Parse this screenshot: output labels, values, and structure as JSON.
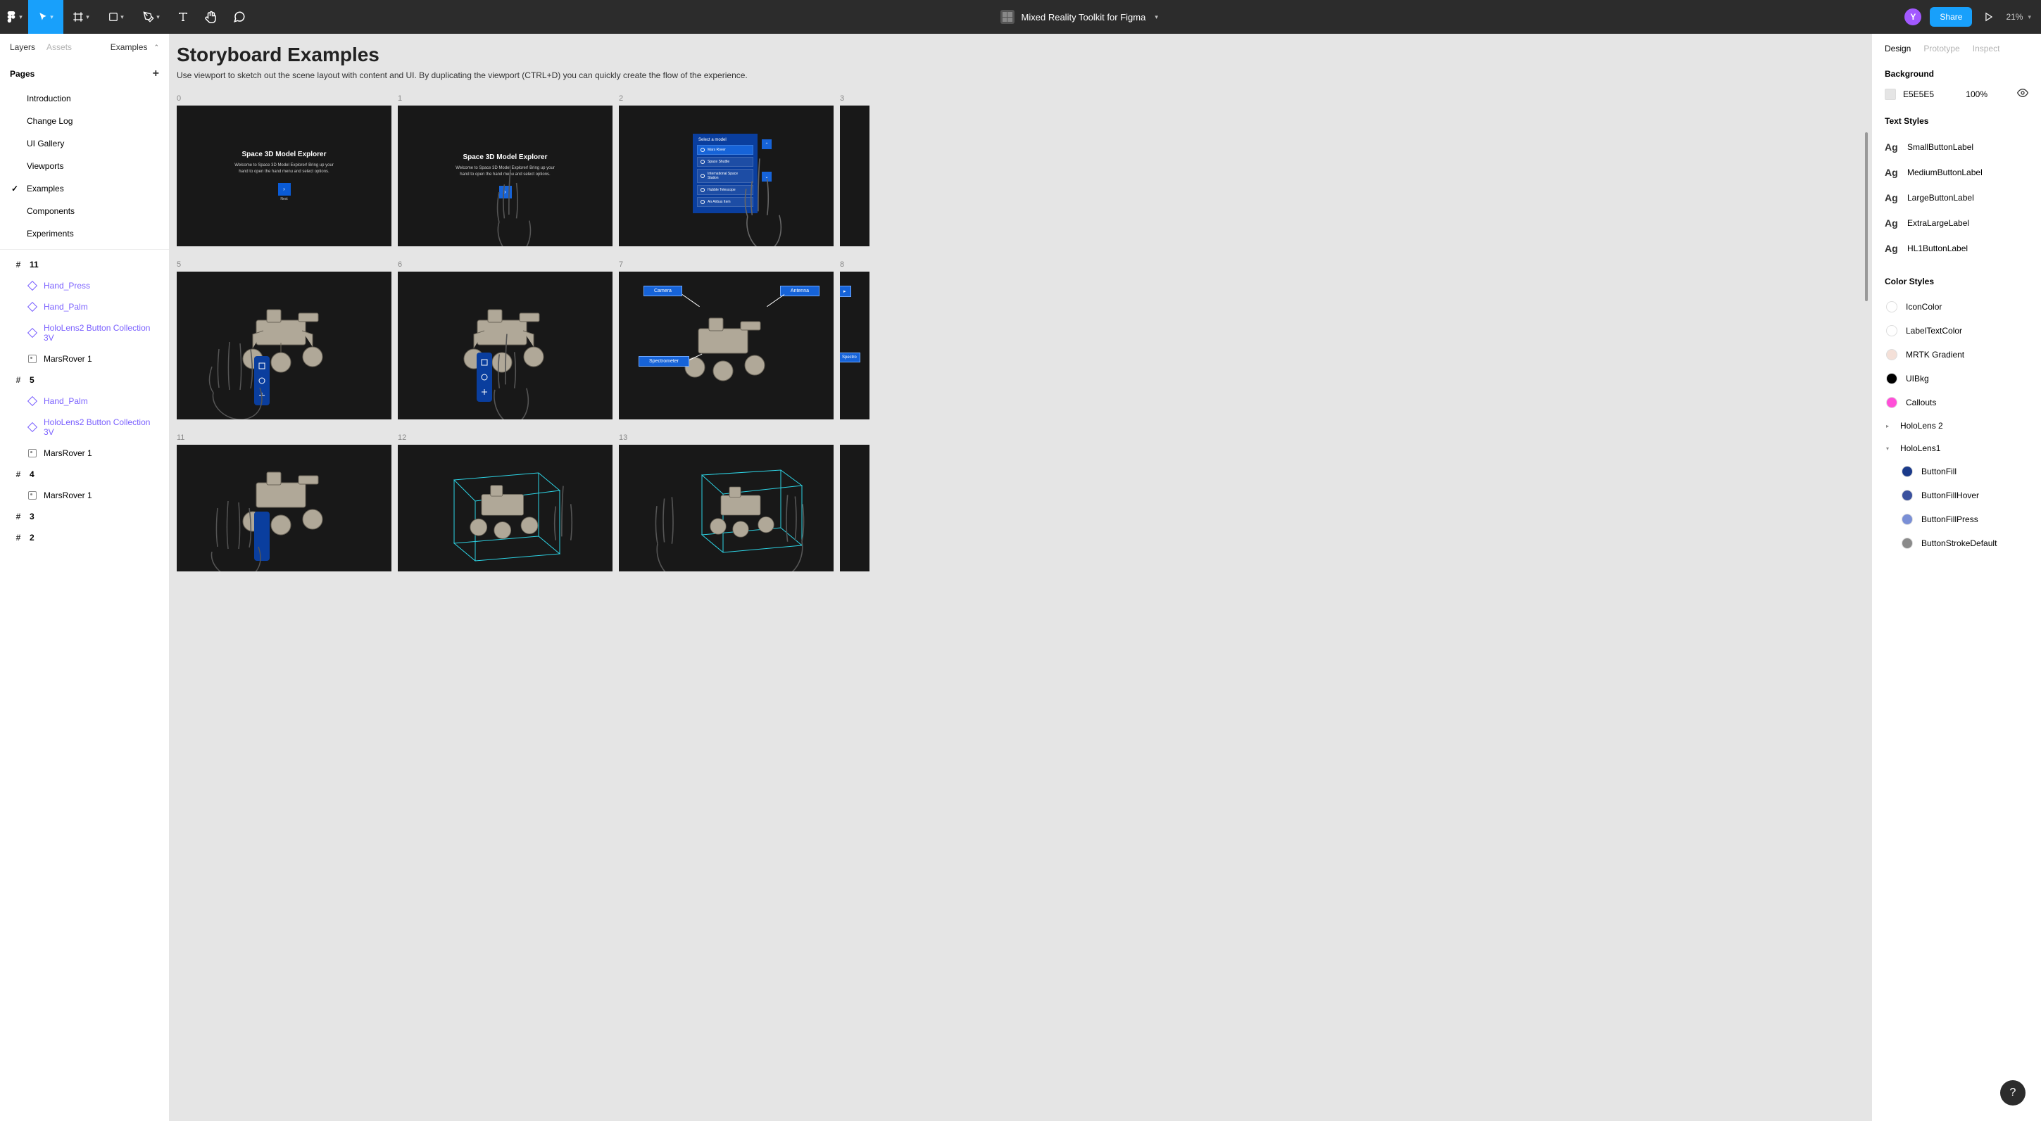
{
  "topbar": {
    "title": "Mixed Reality Toolkit for Figma",
    "share": "Share",
    "zoom": "21%",
    "avatar": "Y"
  },
  "left": {
    "tabs": {
      "layers": "Layers",
      "assets": "Assets",
      "current": "Examples"
    },
    "pages_label": "Pages",
    "pages": [
      {
        "name": "Introduction"
      },
      {
        "name": "Change Log"
      },
      {
        "name": "UI Gallery"
      },
      {
        "name": "Viewports"
      },
      {
        "name": "Examples",
        "active": true
      },
      {
        "name": "Components"
      },
      {
        "name": "Experiments"
      }
    ],
    "frames": [
      {
        "name": "11",
        "items": [
          {
            "name": "Hand_Press",
            "type": "component"
          },
          {
            "name": "Hand_Palm",
            "type": "component"
          },
          {
            "name": "HoloLens2 Button Collection 3V",
            "type": "component"
          },
          {
            "name": "MarsRover 1",
            "type": "image"
          }
        ]
      },
      {
        "name": "5",
        "items": [
          {
            "name": "Hand_Palm",
            "type": "component"
          },
          {
            "name": "HoloLens2 Button Collection 3V",
            "type": "component"
          },
          {
            "name": "MarsRover 1",
            "type": "image"
          }
        ]
      },
      {
        "name": "4",
        "items": [
          {
            "name": "MarsRover 1",
            "type": "image"
          }
        ]
      },
      {
        "name": "3",
        "items": []
      },
      {
        "name": "2",
        "items": []
      }
    ]
  },
  "canvas": {
    "title": "Storyboard Examples",
    "subtitle": "Use viewport to sketch out the scene layout with content and UI. By duplicating the viewport (CTRL+D) you can quickly create the flow of the experience.",
    "vp_labels": [
      "0",
      "1",
      "2",
      "3",
      "5",
      "6",
      "7",
      "8",
      "11",
      "12",
      "13"
    ],
    "space_title": "Space 3D Model Explorer",
    "space_body": "Welcome to Space 3D Model Explorer! Bring up your hand to open the hand menu and select options.",
    "next_label": "Next",
    "menu_head": "Select a model",
    "menu_items": [
      "Mars Rover",
      "Space Shuttle",
      "International Space Station",
      "Hubble Telescope",
      "An Airbus Item"
    ],
    "callouts": {
      "camera": "Camera",
      "antenna": "Antenna",
      "spectrometer": "Spectrometer",
      "spectro_short": "Spectro"
    }
  },
  "right": {
    "tabs": {
      "design": "Design",
      "prototype": "Prototype",
      "inspect": "Inspect"
    },
    "bg_label": "Background",
    "bg_hex": "E5E5E5",
    "bg_opacity": "100%",
    "ts_label": "Text Styles",
    "ag": "Ag",
    "text_styles": [
      "SmallButtonLabel",
      "MediumButtonLabel",
      "LargeButtonLabel",
      "ExtraLargeLabel",
      "HL1ButtonLabel"
    ],
    "cs_label": "Color Styles",
    "color_styles": [
      {
        "name": "IconColor",
        "c": "#ffffff"
      },
      {
        "name": "LabelTextColor",
        "c": "#ffffff"
      },
      {
        "name": "MRTK Gradient",
        "c": "#f4e0d8"
      },
      {
        "name": "UIBkg",
        "c": "#000000"
      },
      {
        "name": "Callouts",
        "c": "#ff4fd8"
      }
    ],
    "groups": [
      {
        "name": "HoloLens 2",
        "open": false
      },
      {
        "name": "HoloLens1",
        "open": true,
        "items": [
          {
            "name": "ButtonFill",
            "c": "#1b3a8a"
          },
          {
            "name": "ButtonFillHover",
            "c": "#3a519e"
          },
          {
            "name": "ButtonFillPress",
            "c": "#7a8fd6"
          },
          {
            "name": "ButtonStrokeDefault",
            "c": "#8a8a8a"
          }
        ]
      }
    ]
  },
  "help": "?"
}
